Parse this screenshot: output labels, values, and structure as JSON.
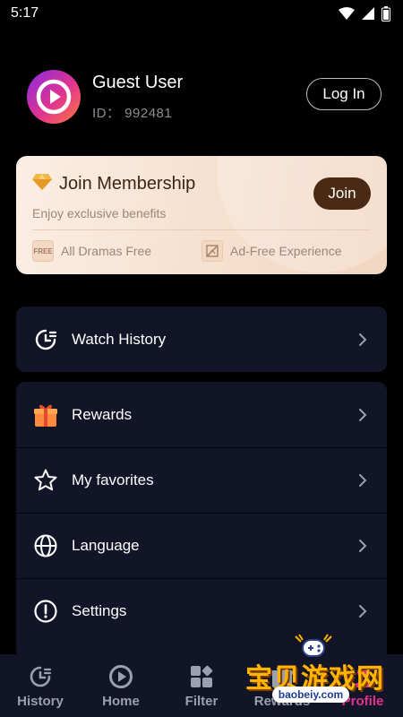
{
  "status_bar": {
    "time": "5:17",
    "icons": [
      "wifi-icon",
      "signal-icon",
      "battery-icon"
    ]
  },
  "profile": {
    "name": "Guest User",
    "id_text": "ID： 992481",
    "login_label": "Log In"
  },
  "membership": {
    "title": "Join Membership",
    "subtitle": "Enjoy exclusive benefits",
    "join_label": "Join",
    "features": [
      {
        "icon": "free-badge-icon",
        "badge": "FREE",
        "label": "All Dramas Free"
      },
      {
        "icon": "ad-free-icon",
        "label": "Ad-Free Experience"
      }
    ]
  },
  "menu_primary": [
    {
      "icon": "clock-history-icon",
      "label": "Watch History"
    }
  ],
  "menu_secondary": [
    {
      "icon": "gift-icon",
      "label": "Rewards"
    },
    {
      "icon": "star-icon",
      "label": "My favorites"
    },
    {
      "icon": "globe-icon",
      "label": "Language"
    },
    {
      "icon": "info-icon",
      "label": "Settings"
    }
  ],
  "tab_bar": [
    {
      "icon": "clock-history-icon",
      "label": "History",
      "active": false
    },
    {
      "icon": "play-icon",
      "label": "Home",
      "active": false
    },
    {
      "icon": "filter-grid-icon",
      "label": "Filter",
      "active": false
    },
    {
      "icon": "gift-icon",
      "label": "Rewards",
      "active": false
    },
    {
      "icon": "profile-icon",
      "label": "Profile",
      "active": true
    }
  ],
  "watermark": {
    "text": "宝贝游戏网",
    "url": "baobeiy.com"
  },
  "colors": {
    "accent": "#e0338f",
    "card": "#111527",
    "join_button": "#4a2a14",
    "membership_bg": "#f6e0cf"
  }
}
